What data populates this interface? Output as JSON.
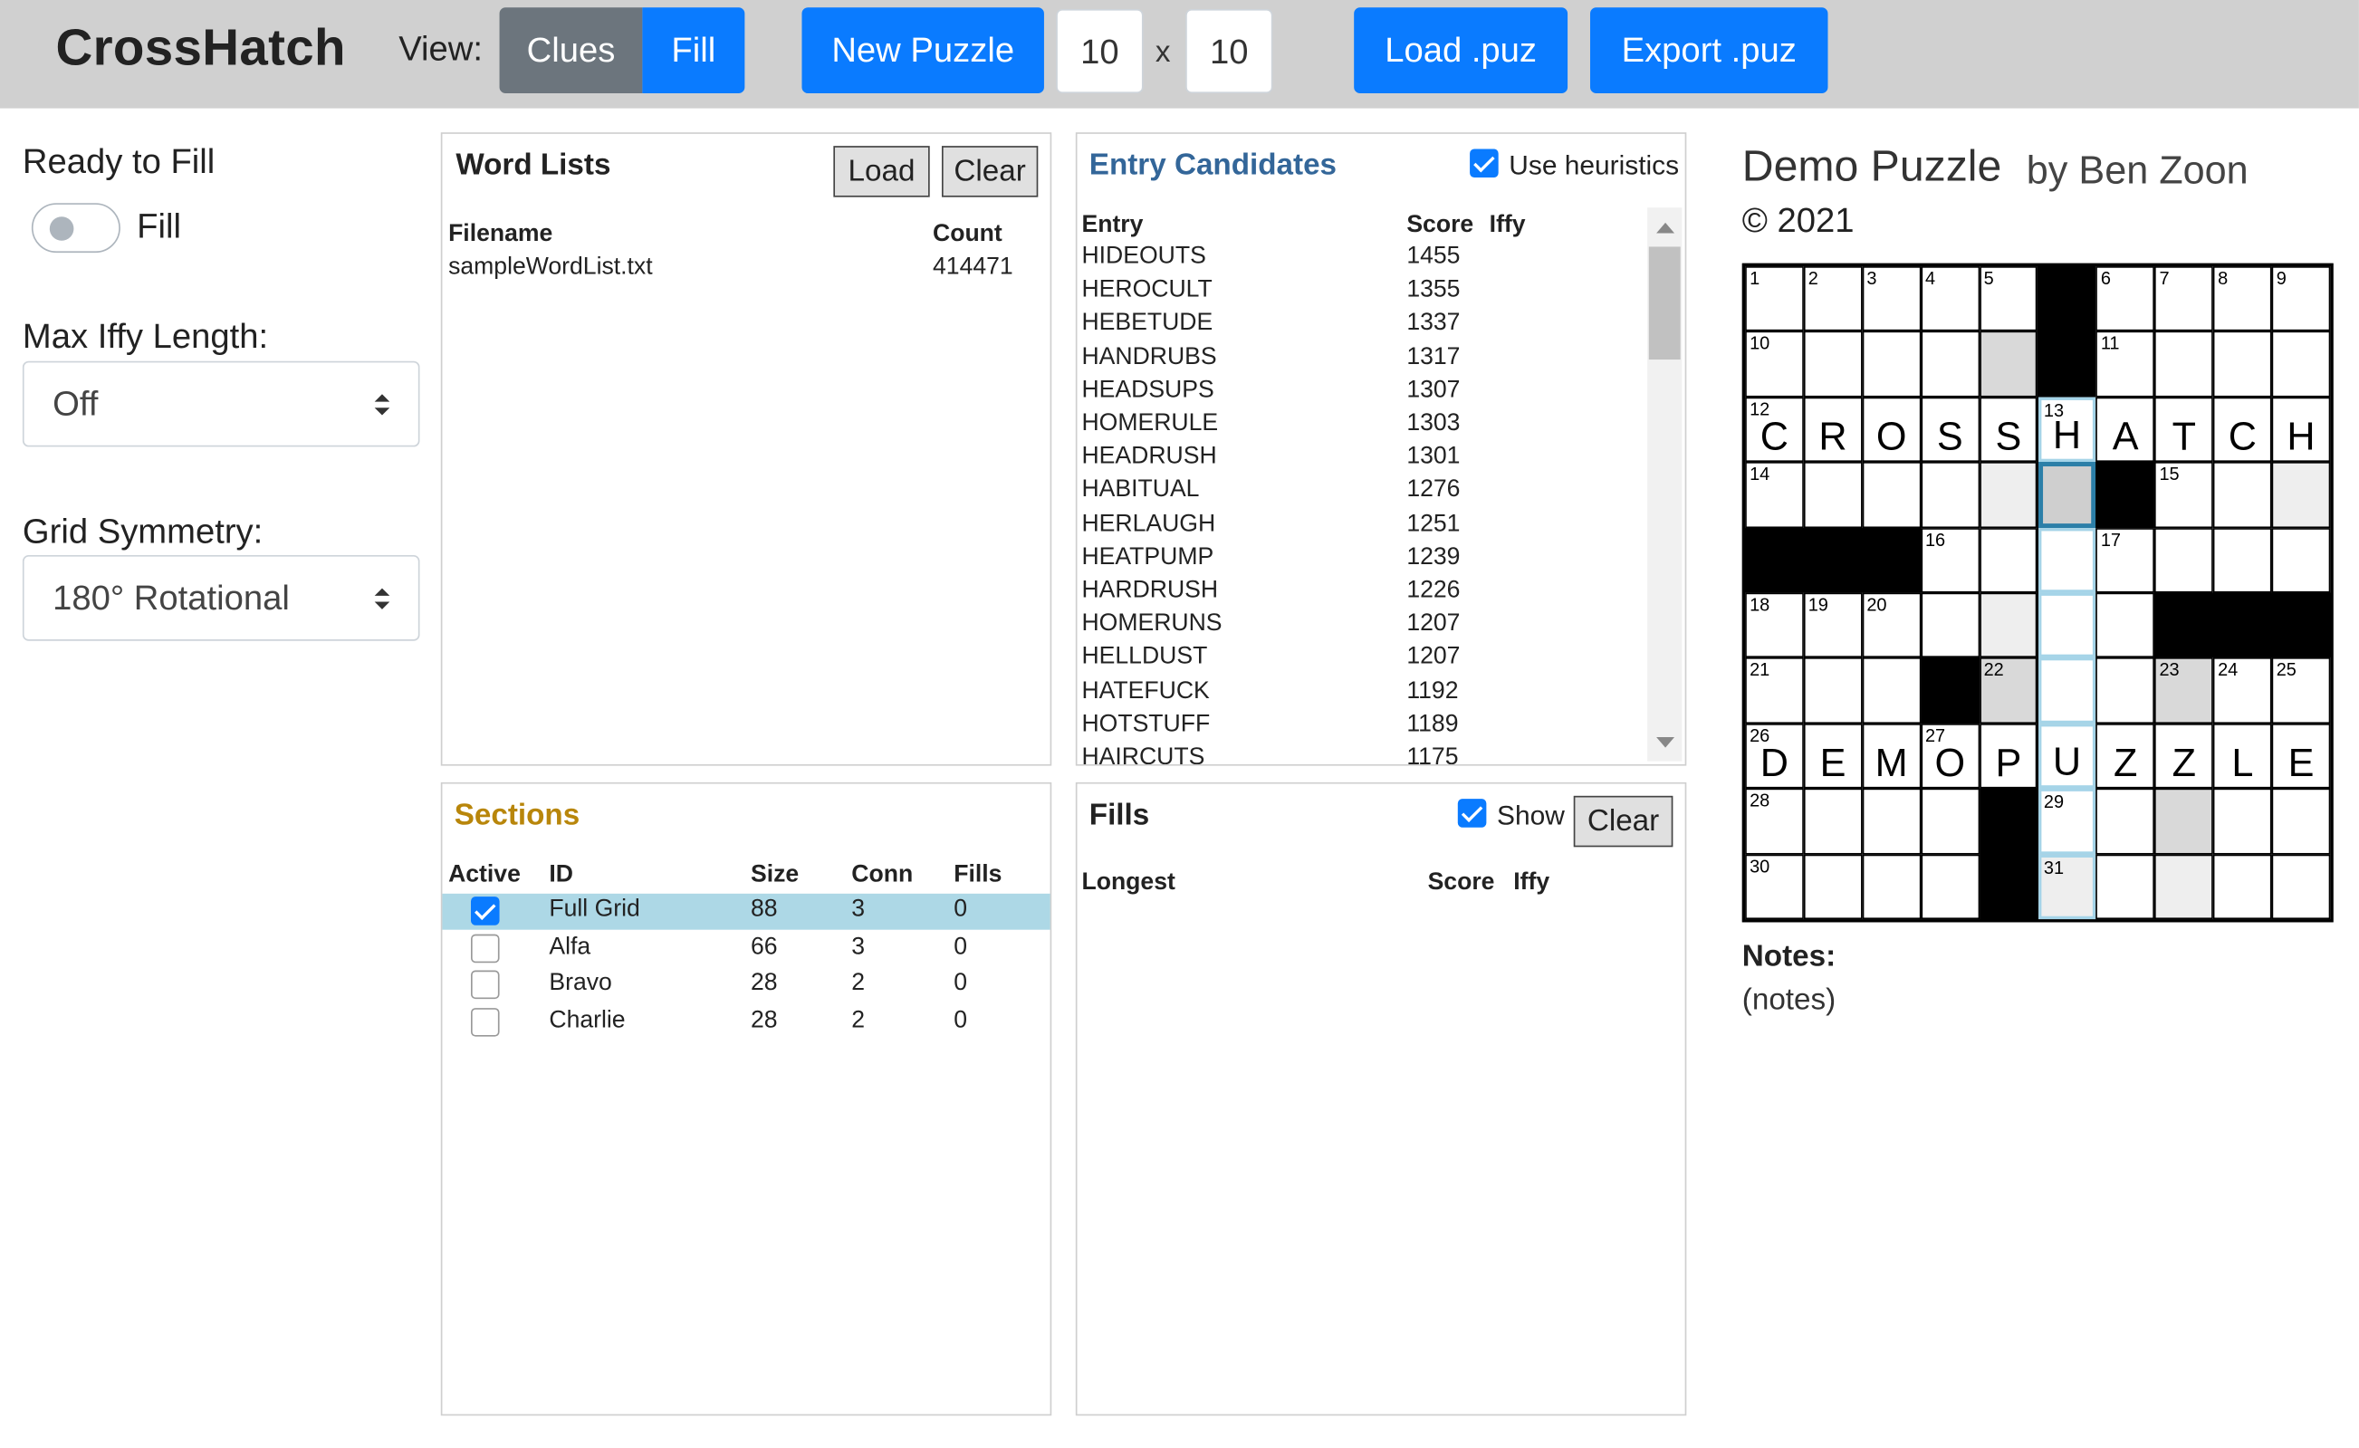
{
  "header": {
    "brand": "CrossHatch",
    "view_label": "View:",
    "view_clues": "Clues",
    "view_fill": "Fill",
    "new_puzzle": "New Puzzle",
    "width": "10",
    "x_label": "x",
    "height": "10",
    "load_puz": "Load .puz",
    "export_puz": "Export .puz"
  },
  "left": {
    "ready_label": "Ready to Fill",
    "fill_toggle_label": "Fill",
    "max_iffy_label": "Max Iffy Length:",
    "max_iffy_value": "Off",
    "symmetry_label": "Grid Symmetry:",
    "symmetry_value": "180° Rotational"
  },
  "word_lists": {
    "title": "Word Lists",
    "load": "Load",
    "clear": "Clear",
    "col_filename": "Filename",
    "col_count": "Count",
    "rows": [
      {
        "filename": "sampleWordList.txt",
        "count": "414471"
      }
    ]
  },
  "sections": {
    "title": "Sections",
    "title_color": "#b8860b",
    "col_active": "Active",
    "col_id": "ID",
    "col_size": "Size",
    "col_conn": "Conn",
    "col_fills": "Fills",
    "selected_color": "#add8e6",
    "rows": [
      {
        "active": true,
        "id": "Full Grid",
        "size": "88",
        "conn": "3",
        "fills": "0",
        "selected": true
      },
      {
        "active": false,
        "id": "Alfa",
        "size": "66",
        "conn": "3",
        "fills": "0",
        "selected": false
      },
      {
        "active": false,
        "id": "Bravo",
        "size": "28",
        "conn": "2",
        "fills": "0",
        "selected": false
      },
      {
        "active": false,
        "id": "Charlie",
        "size": "28",
        "conn": "2",
        "fills": "0",
        "selected": false
      }
    ]
  },
  "candidates": {
    "title": "Entry Candidates",
    "title_color": "#336699",
    "heuristics_label": "Use heuristics",
    "heuristics_checked": true,
    "col_entry": "Entry",
    "col_score": "Score",
    "col_iffy": "Iffy",
    "rows": [
      {
        "entry": "HIDEOUTS",
        "score": "1455"
      },
      {
        "entry": "HEROCULT",
        "score": "1355"
      },
      {
        "entry": "HEBETUDE",
        "score": "1337"
      },
      {
        "entry": "HANDRUBS",
        "score": "1317"
      },
      {
        "entry": "HEADSUPS",
        "score": "1307"
      },
      {
        "entry": "HOMERULE",
        "score": "1303"
      },
      {
        "entry": "HEADRUSH",
        "score": "1301"
      },
      {
        "entry": "HABITUAL",
        "score": "1276"
      },
      {
        "entry": "HERLAUGH",
        "score": "1251"
      },
      {
        "entry": "HEATPUMP",
        "score": "1239"
      },
      {
        "entry": "HARDRUSH",
        "score": "1226"
      },
      {
        "entry": "HOMERUNS",
        "score": "1207"
      },
      {
        "entry": "HELLDUST",
        "score": "1207"
      },
      {
        "entry": "HATEFUCK",
        "score": "1192"
      },
      {
        "entry": "HOTSTUFF",
        "score": "1189"
      },
      {
        "entry": "HAIRCUTS",
        "score": "1175"
      }
    ]
  },
  "fills": {
    "title": "Fills",
    "show_label": "Show",
    "show_checked": true,
    "clear": "Clear",
    "col_longest": "Longest",
    "col_score": "Score",
    "col_iffy": "Iffy"
  },
  "puzzle": {
    "title": "Demo Puzzle",
    "author": "by Ben Zoon",
    "copyright": "© 2021",
    "notes_label": "Notes:",
    "notes": "(notes)",
    "rows": 10,
    "cols": 10,
    "cells": [
      [
        {
          "n": "1"
        },
        {
          "n": "2"
        },
        {
          "n": "3"
        },
        {
          "n": "4"
        },
        {
          "n": "5"
        },
        {
          "b": 1
        },
        {
          "n": "6"
        },
        {
          "n": "7"
        },
        {
          "n": "8"
        },
        {
          "n": "9"
        }
      ],
      [
        {
          "n": "10"
        },
        {},
        {},
        {},
        {
          "s": "shade"
        },
        {
          "b": 1
        },
        {
          "n": "11"
        },
        {},
        {},
        {}
      ],
      [
        {
          "n": "12",
          "l": "C"
        },
        {
          "l": "R"
        },
        {
          "l": "O"
        },
        {
          "l": "S"
        },
        {
          "l": "S"
        },
        {
          "n": "13",
          "l": "H",
          "s": "hl"
        },
        {
          "l": "A"
        },
        {
          "l": "T"
        },
        {
          "l": "C"
        },
        {
          "l": "H"
        }
      ],
      [
        {
          "n": "14"
        },
        {},
        {},
        {},
        {
          "s": "lite"
        },
        {
          "s": "cur"
        },
        {
          "b": 1
        },
        {
          "n": "15"
        },
        {},
        {
          "s": "lite"
        }
      ],
      [
        {
          "b": 1
        },
        {
          "b": 1
        },
        {
          "b": 1
        },
        {
          "n": "16"
        },
        {},
        {
          "s": "hl"
        },
        {
          "n": "17"
        },
        {},
        {},
        {}
      ],
      [
        {
          "n": "18"
        },
        {
          "n": "19"
        },
        {
          "n": "20"
        },
        {},
        {
          "s": "lite"
        },
        {
          "s": "hl"
        },
        {},
        {
          "b": 1
        },
        {
          "b": 1
        },
        {
          "b": 1
        }
      ],
      [
        {
          "n": "21"
        },
        {},
        {},
        {
          "b": 1
        },
        {
          "n": "22",
          "s": "shade"
        },
        {
          "s": "hl"
        },
        {},
        {
          "n": "23",
          "s": "shade"
        },
        {
          "n": "24"
        },
        {
          "n": "25"
        }
      ],
      [
        {
          "n": "26",
          "l": "D"
        },
        {
          "l": "E"
        },
        {
          "l": "M"
        },
        {
          "n": "27",
          "l": "O"
        },
        {
          "l": "P"
        },
        {
          "l": "U",
          "s": "hl"
        },
        {
          "l": "Z"
        },
        {
          "l": "Z"
        },
        {
          "l": "L"
        },
        {
          "l": "E"
        }
      ],
      [
        {
          "n": "28"
        },
        {},
        {},
        {},
        {
          "b": 1
        },
        {
          "n": "29",
          "s": "hl"
        },
        {},
        {
          "s": "shade"
        },
        {},
        {}
      ],
      [
        {
          "n": "30"
        },
        {},
        {},
        {},
        {
          "b": 1
        },
        {
          "n": "31",
          "s": "hl lite"
        },
        {},
        {
          "s": "lite"
        },
        {},
        {}
      ]
    ]
  }
}
